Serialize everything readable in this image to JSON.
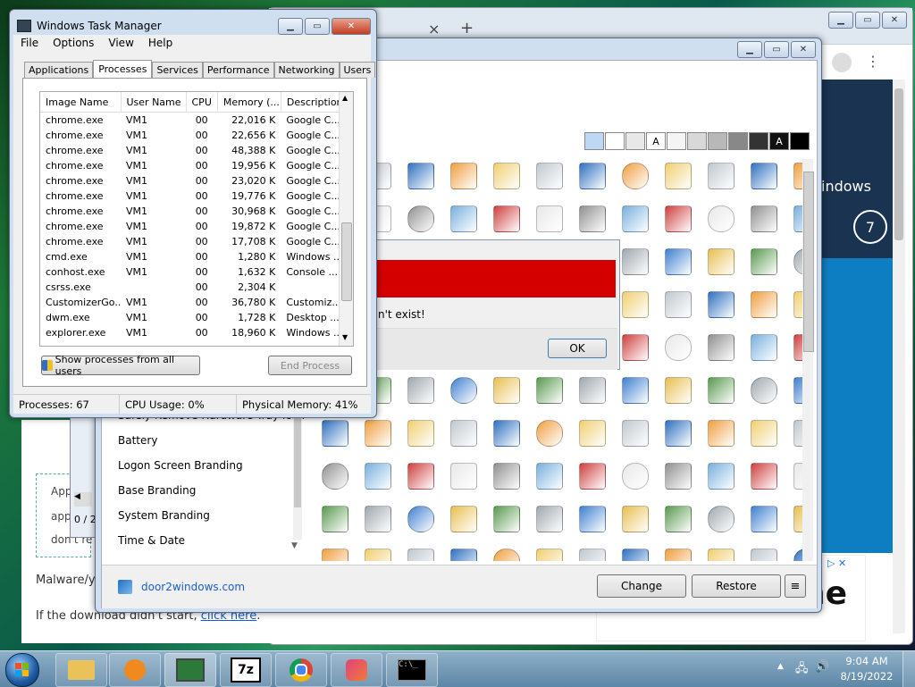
{
  "chrome_bg": {
    "tab_close": "×",
    "tab_new": "+",
    "side_text": "indows",
    "badge_num": "7",
    "ad_text": "ne",
    "page_text_1": "App",
    "page_text_2": "app",
    "page_text_3": "don't re",
    "malware_text": "Malware/y",
    "download_text": "If the download didn't start,",
    "download_link": "click here",
    "download_end": "."
  },
  "error_dialog": {
    "message": "n't exist!",
    "ok_label": "OK"
  },
  "customizer": {
    "list_items": [
      "Safely Remove Hardware Tray Icon",
      "Battery",
      "Logon Screen Branding",
      "Base Branding",
      "System Branding",
      "Time & Date"
    ],
    "link_label": "door2windows.com",
    "change_label": "Change",
    "restore_label": "Restore",
    "menu_label": "≡",
    "small_left_text": "0 / 2",
    "swatches": [
      "#bcd8f2",
      "#ffffff",
      "#e8e8e8",
      "#ffffff",
      "#f4f4f4",
      "#d8d8d8",
      "#b8b8b8",
      "#888888",
      "#333333",
      "#111111",
      "#000000"
    ],
    "swatch_letters": [
      "",
      "",
      "",
      "A",
      "",
      "",
      "",
      "",
      "",
      "A",
      ""
    ]
  },
  "task_manager": {
    "title": "Windows Task Manager",
    "menu": [
      "File",
      "Options",
      "View",
      "Help"
    ],
    "tabs": [
      "Applications",
      "Processes",
      "Services",
      "Performance",
      "Networking",
      "Users"
    ],
    "columns": [
      "Image Name",
      "User Name",
      "CPU",
      "Memory (...",
      "Description"
    ],
    "rows": [
      [
        "chrome.exe",
        "VM1",
        "00",
        "22,016 K",
        "Google C..."
      ],
      [
        "chrome.exe",
        "VM1",
        "00",
        "22,656 K",
        "Google C..."
      ],
      [
        "chrome.exe",
        "VM1",
        "00",
        "48,388 K",
        "Google C..."
      ],
      [
        "chrome.exe",
        "VM1",
        "00",
        "19,956 K",
        "Google C..."
      ],
      [
        "chrome.exe",
        "VM1",
        "00",
        "23,020 K",
        "Google C..."
      ],
      [
        "chrome.exe",
        "VM1",
        "00",
        "19,776 K",
        "Google C..."
      ],
      [
        "chrome.exe",
        "VM1",
        "00",
        "30,968 K",
        "Google C..."
      ],
      [
        "chrome.exe",
        "VM1",
        "00",
        "19,872 K",
        "Google C..."
      ],
      [
        "chrome.exe",
        "VM1",
        "00",
        "17,708 K",
        "Google C..."
      ],
      [
        "cmd.exe",
        "VM1",
        "00",
        "1,280 K",
        "Windows ..."
      ],
      [
        "conhost.exe",
        "VM1",
        "00",
        "1,632 K",
        "Console ..."
      ],
      [
        "csrss.exe",
        "",
        "00",
        "2,304 K",
        ""
      ],
      [
        "CustomizerGo...",
        "VM1",
        "00",
        "36,780 K",
        "Customiz..."
      ],
      [
        "dwm.exe",
        "VM1",
        "00",
        "1,728 K",
        "Desktop ..."
      ],
      [
        "explorer.exe",
        "VM1",
        "00",
        "18,960 K",
        "Windows ..."
      ]
    ],
    "show_all_label": "Show processes from all users",
    "end_process_label": "End Process",
    "status_processes": "Processes: 67",
    "status_cpu": "CPU Usage: 0%",
    "status_memory": "Physical Memory: 41%"
  },
  "taskbar": {
    "time": "9:04 AM",
    "date": "8/19/2022",
    "sevenzip_label": "7z",
    "cmd_label": "C:\\_"
  }
}
